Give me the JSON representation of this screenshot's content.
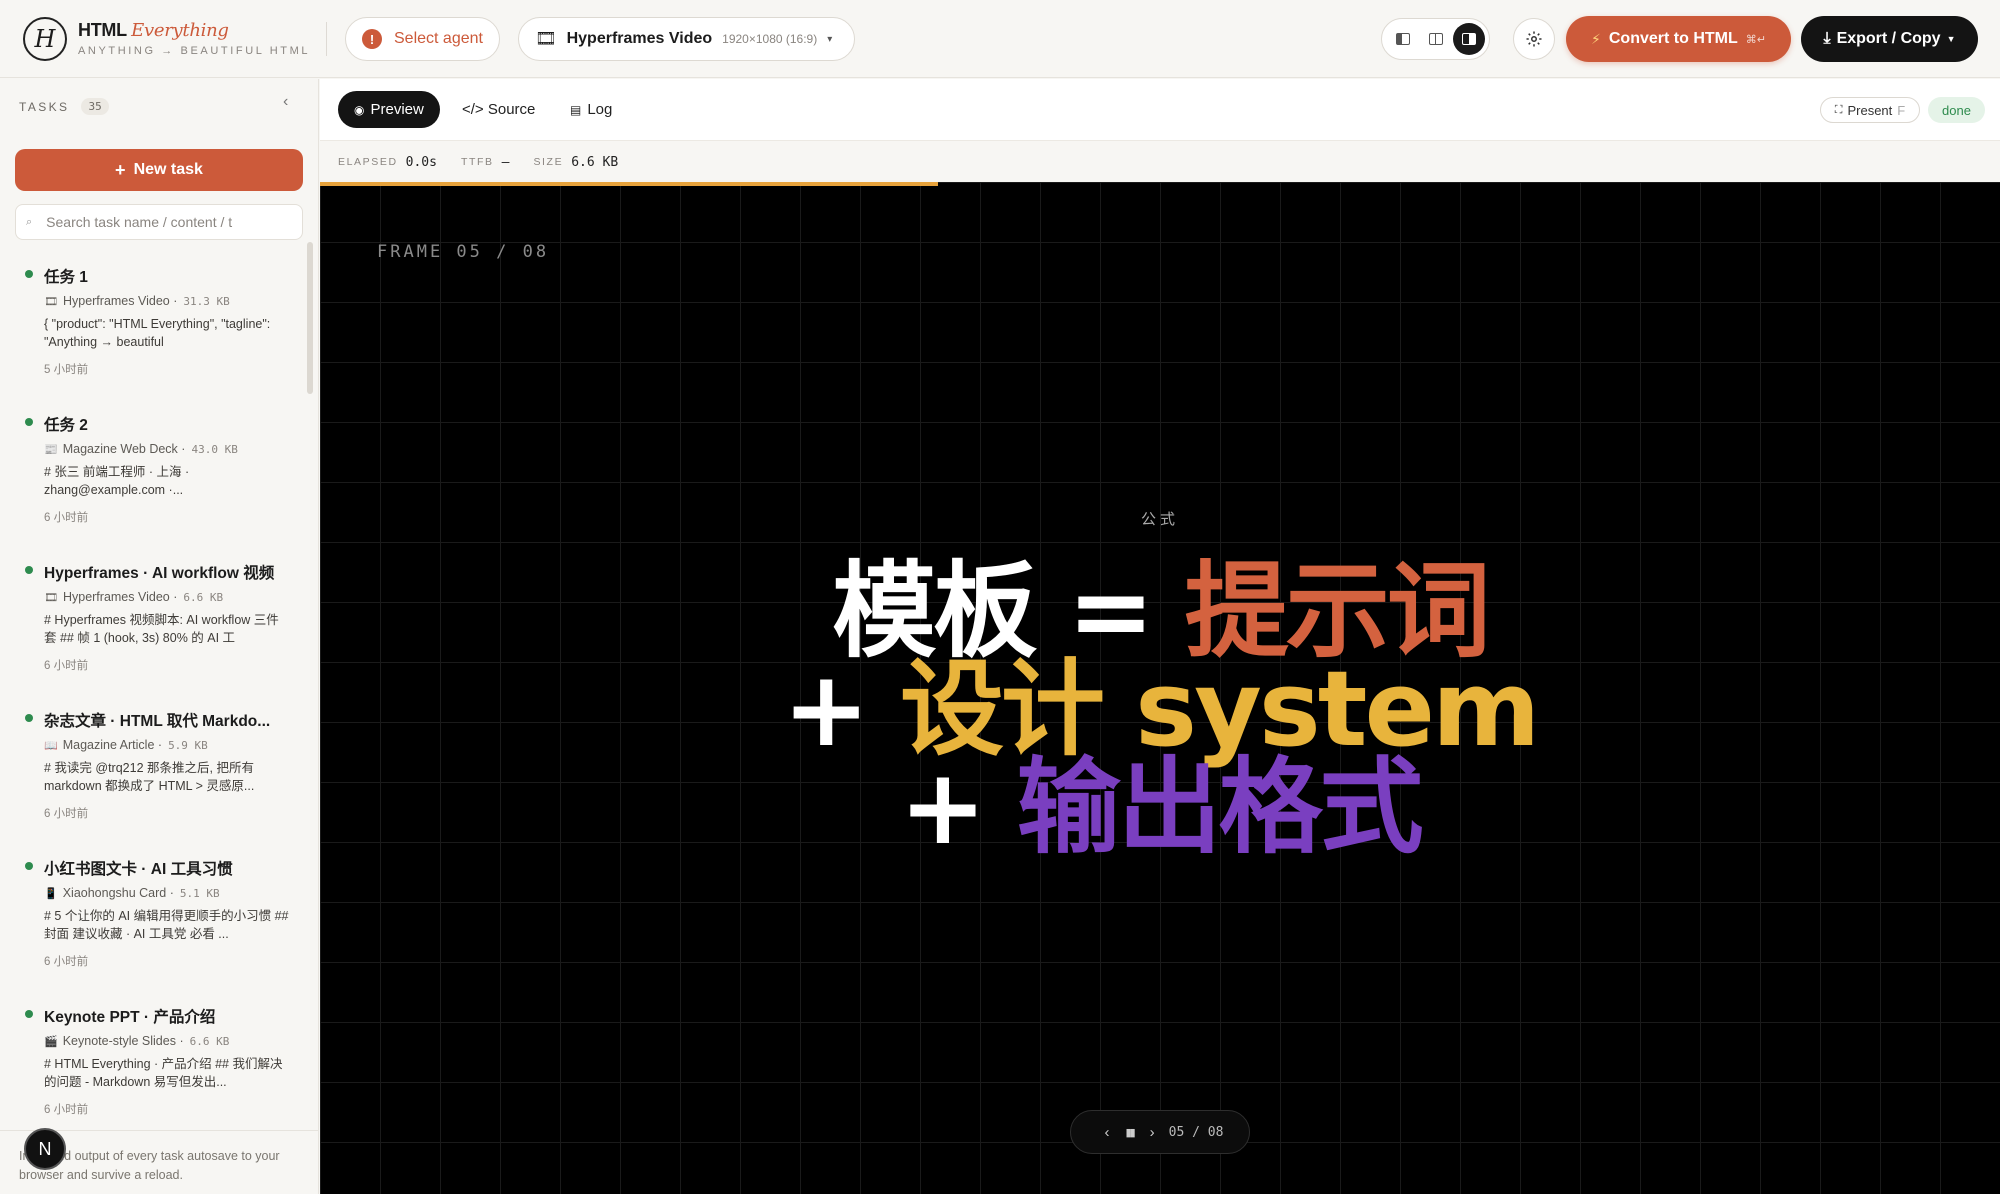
{
  "app": {
    "logo_letter": "H",
    "brand_main": "HTML",
    "brand_accent": "Everything",
    "tagline": "ANYTHING → BEAUTIFUL HTML",
    "accent_color": "#cc5a3a"
  },
  "toolbar": {
    "agent_label": "Select agent",
    "format_icon": "film-icon",
    "format_name": "Hyperframes Video",
    "format_dim": "1920×1080 (16:9)",
    "convert_label": "Convert to HTML",
    "convert_kbd": "⌘↵",
    "export_label": "Export / Copy"
  },
  "sidebar": {
    "tasks_label": "TASKS",
    "tasks_count": "35",
    "new_task_label": "New task",
    "search_placeholder": "Search task name / content / t",
    "tasks": [
      {
        "title": "任务 1",
        "type": "Hyperframes Video",
        "size": "31.3 KB",
        "snippet": "{ \"product\": \"HTML Everything\", \"tagline\": \"Anything → beautiful",
        "time": "5 小时前"
      },
      {
        "title": "任务 2",
        "type": "Magazine Web Deck",
        "size": "43.0 KB",
        "snippet": "# 张三 前端工程师 · 上海 · zhang@example.com ·...",
        "time": "6 小时前"
      },
      {
        "title": "Hyperframes · AI workflow 视频",
        "type": "Hyperframes Video",
        "size": "6.6 KB",
        "snippet": "# Hyperframes 视频脚本: AI workflow 三件套 ## 帧 1 (hook, 3s) 80% 的 AI 工",
        "time": "6 小时前"
      },
      {
        "title": "杂志文章 · HTML 取代 Markdo...",
        "type": "Magazine Article",
        "size": "5.9 KB",
        "snippet": "# 我读完 @trq212 那条推之后, 把所有 markdown 都换成了 HTML > 灵感原...",
        "time": "6 小时前"
      },
      {
        "title": "小红书图文卡 · AI 工具习惯",
        "type": "Xiaohongshu Card",
        "size": "5.1 KB",
        "snippet": "# 5 个让你的 AI 编辑用得更顺手的小习惯 ## 封面 建议收藏 · AI 工具党 必看 ...",
        "time": "6 小时前"
      },
      {
        "title": "Keynote PPT · 产品介绍",
        "type": "Keynote-style Slides",
        "size": "6.6 KB",
        "snippet": "# HTML Everything · 产品介绍 ## 我们解决的问题 - Markdown 易写但发出...",
        "time": "6 小时前"
      }
    ],
    "footer_text": "Input and output of every task autosave to your browser and survive a reload.",
    "user_initial": "N"
  },
  "main": {
    "tabs": [
      {
        "label": "Preview",
        "icon": "eye-icon"
      },
      {
        "label": "</> Source",
        "icon": ""
      },
      {
        "label": "Log",
        "icon": "log-icon"
      }
    ],
    "present_label": "Present",
    "present_kbd": "F",
    "status": "done",
    "stats": {
      "elapsed_label": "ELAPSED",
      "elapsed_value": "0.0s",
      "ttfb_label": "TTFB",
      "ttfb_value": "—",
      "size_label": "SIZE",
      "size_value": "6.6 KB"
    },
    "preview": {
      "progress_fraction": 0.368,
      "frame_label": "FRAME 05 / 08",
      "kicker": "公式",
      "line1_a": "模板 = ",
      "line1_b": "提示词",
      "line2_a": "+ ",
      "line2_b": "设计 system",
      "line3_a": "+ ",
      "line3_b": "输出格式",
      "counter": "05 / 08",
      "colors": {
        "orange": "#d4623f",
        "yellow": "#e8b43c",
        "purple": "#7a3fc0"
      }
    }
  }
}
